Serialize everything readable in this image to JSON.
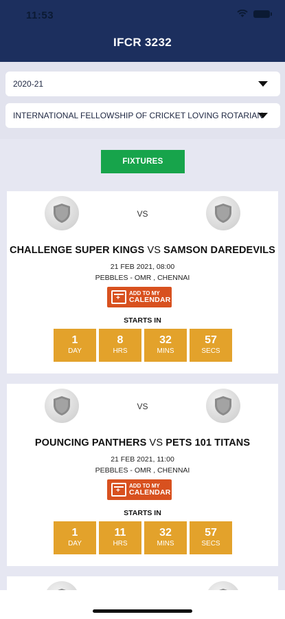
{
  "status_bar": {
    "time": "11:53"
  },
  "header": {
    "title": "IFCR 3232"
  },
  "filters": {
    "season": "2020-21",
    "organization": "INTERNATIONAL FELLOWSHIP OF CRICKET LOVING ROTARIAN"
  },
  "fixtures_button": "FIXTURES",
  "matches": [
    {
      "team_a": "CHALLENGE SUPER KINGS",
      "vs": "VS",
      "team_b": "SAMSON DAREDEVILS",
      "vs_mid": "VS",
      "date": "21 FEB 2021, 08:00",
      "venue": "PEBBLES - OMR ,  CHENNAI",
      "calendar": {
        "line1": "ADD TO MY",
        "line2": "CALENDAR"
      },
      "starts_in": "STARTS IN",
      "countdown": [
        {
          "value": "1",
          "unit": "DAY"
        },
        {
          "value": "8",
          "unit": "HRS"
        },
        {
          "value": "32",
          "unit": "MINS"
        },
        {
          "value": "57",
          "unit": "SECS"
        }
      ]
    },
    {
      "team_a": "POUNCING PANTHERS",
      "vs": "VS",
      "team_b": "PETS 101 TITANS",
      "vs_mid": "VS",
      "date": "21 FEB 2021, 11:00",
      "venue": "PEBBLES - OMR ,  CHENNAI",
      "calendar": {
        "line1": "ADD TO MY",
        "line2": "CALENDAR"
      },
      "starts_in": "STARTS IN",
      "countdown": [
        {
          "value": "1",
          "unit": "DAY"
        },
        {
          "value": "11",
          "unit": "HRS"
        },
        {
          "value": "32",
          "unit": "MINS"
        },
        {
          "value": "57",
          "unit": "SECS"
        }
      ]
    }
  ],
  "colors": {
    "header": "#1c2f5e",
    "fixtures_button": "#17a44b",
    "countdown": "#e3a22b",
    "calendar_button": "#d8511f"
  },
  "icons": [
    "wifi-icon",
    "battery-icon",
    "dropdown-caret-icon",
    "team-logo-icon",
    "calendar-icon"
  ]
}
